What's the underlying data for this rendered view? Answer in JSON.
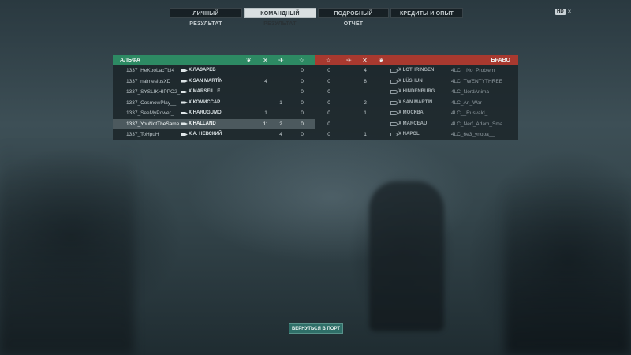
{
  "tabs": [
    {
      "label": "ЛИЧНЫЙ РЕЗУЛЬТАТ",
      "active": false
    },
    {
      "label": "КОМАНДНЫЙ РЕЗУЛЬТАТ",
      "active": true
    },
    {
      "label": "ПОДРОБНЫЙ ОТЧЁТ",
      "active": false
    },
    {
      "label": "КРЕДИТЫ И ОПЫТ",
      "active": false
    }
  ],
  "hud": {
    "badge": "HD",
    "close": "×"
  },
  "alpha": {
    "name": "АЛЬФА",
    "color": "#2d8a63",
    "columns": [
      "laurel-icon",
      "kills-icon",
      "planes-icon",
      "star-icon"
    ],
    "players": [
      {
        "name": "1337_HeKpoLacTbl4_",
        "ship": "X ЛАЗАРЕВ",
        "kills": "",
        "planes": "",
        "base": "0"
      },
      {
        "name": "1337_nalmesiusXD",
        "ship": "X SAN MARTÍN",
        "kills": "4",
        "planes": "",
        "base": "0"
      },
      {
        "name": "1337_SYSLIKHIPPO2_",
        "ship": "X MARSEILLE",
        "kills": "",
        "planes": "",
        "base": "0"
      },
      {
        "name": "1337_CosmowPlay__",
        "ship": "X КОМИССАР",
        "kills": "",
        "planes": "1",
        "base": "0"
      },
      {
        "name": "1337_SeeMyPower_",
        "ship": "X HARUGUMO",
        "kills": "1",
        "planes": "",
        "base": "0"
      },
      {
        "name": "1337_YouNotTheSame...",
        "ship": "X HALLAND",
        "kills": "11",
        "planes": "2",
        "base": "0",
        "me": true
      },
      {
        "name": "1337_ToHpuH",
        "ship": "X A. НЕВСКИЙ",
        "kills": "",
        "planes": "4",
        "base": "0"
      }
    ]
  },
  "bravo": {
    "name": "БРАВО",
    "color": "#a8392f",
    "columns": [
      "star-icon",
      "planes-icon",
      "kills-icon",
      "laurel-icon"
    ],
    "players": [
      {
        "name": "4LC__No_Problem___",
        "ship": "X LOTHRINGEN",
        "base": "0",
        "kills": "4"
      },
      {
        "name": "4LC_TWENTYTHREE_",
        "ship": "X LÜSHUN",
        "base": "0",
        "kills": "8"
      },
      {
        "name": "4LC_NordAnima",
        "ship": "X HINDENBURG",
        "base": "0",
        "kills": ""
      },
      {
        "name": "4LC_An_War",
        "ship": "X SAN MARTÍN",
        "base": "0",
        "kills": "2"
      },
      {
        "name": "4LC__Rusvald_",
        "ship": "X МОСКВА",
        "base": "0",
        "kills": "1"
      },
      {
        "name": "4LC_Nerf_Adam_Sma...",
        "ship": "X MARCEAU",
        "base": "0",
        "kills": ""
      },
      {
        "name": "4LC_6e3_ynopa__",
        "ship": "X NAPOLI",
        "base": "0",
        "kills": "1"
      }
    ]
  },
  "return_button": "ВЕРНУТЬСЯ В ПОРТ"
}
